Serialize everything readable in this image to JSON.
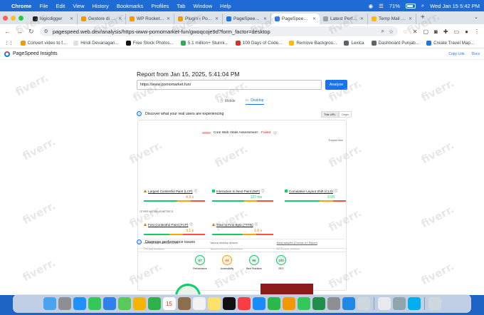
{
  "menubar": {
    "app": "Chrome",
    "items": [
      "File",
      "Edit",
      "View",
      "History",
      "Bookmarks",
      "Profiles",
      "Tab",
      "Window",
      "Help"
    ],
    "battery": "71%",
    "datetime": "Wed Jan 15  5:42 PM"
  },
  "tabs": [
    {
      "title": "logicdigger",
      "color": "#222222",
      "active": false
    },
    {
      "title": "Gestore di file...",
      "color": "#f29900",
      "active": false
    },
    {
      "title": "WP Rocket – P...",
      "color": "#f29900",
      "active": false
    },
    {
      "title": "Plugin ‹ Porno...",
      "color": "#f29900",
      "active": false
    },
    {
      "title": "PageSpeed Ins...",
      "color": "#1a73e8",
      "active": false
    },
    {
      "title": "PageSpeed Ins...",
      "color": "#1a73e8",
      "active": true
    },
    {
      "title": "Latest Perform...",
      "color": "#9aa0a6",
      "active": false
    },
    {
      "title": "Temp Mail – Te...",
      "color": "#fbbc04",
      "active": false
    }
  ],
  "address_bar": {
    "url": "pagespeed.web.dev/analysis/https-www-pornomarket-fun/gwoqcoje9d?form_factor=desktop"
  },
  "bookmarks": [
    {
      "label": "Convert video to f...",
      "color": "#f29900"
    },
    {
      "label": "Hindi Devanagari...",
      "color": "#e0e0e0"
    },
    {
      "label": "Free Stock Photos...",
      "color": "#111111"
    },
    {
      "label": "5.1 million+ Stunni...",
      "color": "#34a853"
    },
    {
      "label": "100 Days of Code...",
      "color": "#d93025"
    },
    {
      "label": "Remove Backgrou...",
      "color": "#fbbc04"
    },
    {
      "label": "Lexica",
      "color": "#5f6368"
    },
    {
      "label": "Dashboard Punjab...",
      "color": "#5f6368"
    },
    {
      "label": "Create Travel Map...",
      "color": "#1a73e8"
    }
  ],
  "psi": {
    "brand": "PageSpeed Insights",
    "header_links": [
      "Copy Link",
      "Docs"
    ],
    "report_title": "Report from Jan 15, 2025, 5:41:04 PM",
    "url_value": "https://www.pornomarket.fun/",
    "analyze_label": "Analyze",
    "device_tabs": [
      "Mobile",
      "Desktop"
    ],
    "cwv_section_title": "Discover what your real users are experiencing",
    "scope_toggle": [
      "This URL",
      "Origin"
    ],
    "cwv_assessment_label": "Core Web Vitals Assessment:",
    "cwv_assessment_status": "Failed",
    "expand_view": "Expand view",
    "metrics": [
      {
        "label": "Largest Contentful Paint (LCP)",
        "value": "4.9 s",
        "status_color": "#e37400",
        "marker": 0.78
      },
      {
        "label": "Interaction to Next Paint (INP)",
        "value": "127 ms",
        "status_color": "#0cce6b",
        "marker": 0.74
      },
      {
        "label": "Cumulative Layout Shift (CLS)",
        "value": "0.05",
        "status_color": "#0cce6b",
        "marker": 0.82
      }
    ],
    "other_metrics_label": "OTHER NOTABLE METRICS",
    "other_metrics": [
      {
        "label": "First Contentful Paint (FCP)",
        "value": "3.1 s",
        "status_color": "#e37400",
        "marker": 0.6
      },
      {
        "label": "Time to First Byte (TTFB)",
        "value": "1.6 s",
        "status_color": "#e37400",
        "marker": 0.72
      }
    ],
    "footnotes": [
      "Latest 28-day collection period",
      "Various desktop devices",
      "Many samples (Chrome UX Report)",
      "Full visit durations",
      "Various network connections",
      "All Chrome versions"
    ],
    "diagnose_title": "Diagnose performance issues",
    "scores": [
      {
        "label": "Performance",
        "value": "97",
        "color": "#0cce6b"
      },
      {
        "label": "Accessibility",
        "value": "83",
        "color": "#ffa400"
      },
      {
        "label": "Best Practices",
        "value": "96",
        "color": "#0cce6b"
      },
      {
        "label": "SEO",
        "value": "100",
        "color": "#0cce6b"
      }
    ]
  },
  "watermark_text": "fiverr.",
  "dock": [
    {
      "name": "Finder",
      "color": "#4aa3f0"
    },
    {
      "name": "Launchpad",
      "color": "#8e8e93"
    },
    {
      "name": "Safari",
      "color": "#1e90ff"
    },
    {
      "name": "Messages",
      "color": "#34c759"
    },
    {
      "name": "Mail",
      "color": "#2f80ed"
    },
    {
      "name": "Maps",
      "color": "#5ac85a"
    },
    {
      "name": "Photos",
      "color": "#f4b400"
    },
    {
      "name": "FaceTime",
      "color": "#2fb04a"
    },
    {
      "name": "Calendar",
      "color": "#ffffff"
    },
    {
      "name": "Notes App",
      "color": "#8d6e4a"
    },
    {
      "name": "Reminders",
      "color": "#f2f2f2"
    },
    {
      "name": "Notes",
      "color": "#fce26a"
    },
    {
      "name": "Apple TV",
      "color": "#111111"
    },
    {
      "name": "Music",
      "color": "#fc3c44"
    },
    {
      "name": "App Store",
      "color": "#1a8cff"
    },
    {
      "name": "Numbers",
      "color": "#2db84d"
    },
    {
      "name": "Pages",
      "color": "#f29900"
    },
    {
      "name": "Find My",
      "color": "#34c759"
    },
    {
      "name": "Screen Recorder",
      "color": "#1f8f4a"
    },
    {
      "name": "System Settings",
      "color": "#8e8e93"
    },
    {
      "name": "VS Code",
      "color": "#1e88e5"
    },
    {
      "name": "Simulator",
      "color": "#cfd8dc"
    },
    {
      "name": "Chrome",
      "color": "#e8eaed"
    },
    {
      "name": "Preview",
      "color": "#90a4ae"
    },
    {
      "name": "Skype",
      "color": "#00aff0"
    },
    {
      "name": "Trash",
      "color": "#cfd8dc"
    }
  ],
  "calendar_day": "15"
}
